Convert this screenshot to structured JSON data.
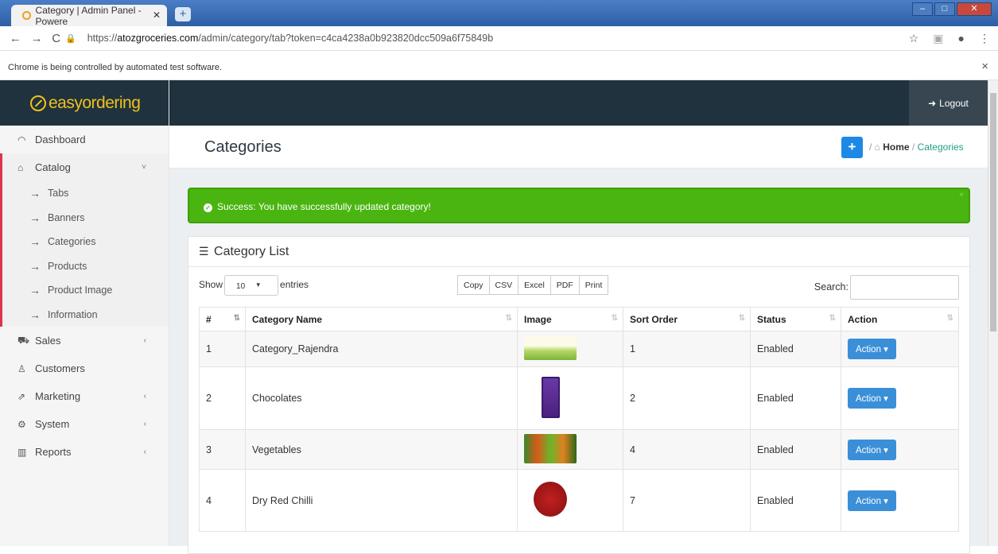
{
  "browser": {
    "tab_title": "Category | Admin Panel - Powere",
    "url_prefix": "https://",
    "url_domain": "atozgroceries.com",
    "url_path": "/admin/category/tab?token=c4ca4238a0b923820dcc509a6f75849b",
    "infobar": "Chrome is being controlled by automated test software."
  },
  "brand": {
    "name": "easyordering"
  },
  "topbar": {
    "logout": "Logout"
  },
  "sidebar": {
    "dashboard": "Dashboard",
    "catalog": "Catalog",
    "sub": [
      "Tabs",
      "Banners",
      "Categories",
      "Products",
      "Product Image",
      "Information"
    ],
    "sales": "Sales",
    "customers": "Customers",
    "marketing": "Marketing",
    "system": "System",
    "reports": "Reports"
  },
  "page": {
    "title": "Categories",
    "breadcrumb_home": "Home",
    "breadcrumb_current": "Categories",
    "add": "+"
  },
  "alert": {
    "text": "Success: You have successfully updated category!"
  },
  "card": {
    "title": "Category List"
  },
  "controls": {
    "show": "Show",
    "entries_value": "10",
    "entries": "entries",
    "buttons": [
      "Copy",
      "CSV",
      "Excel",
      "PDF",
      "Print"
    ],
    "search": "Search:"
  },
  "table": {
    "headers": [
      "#",
      "Category Name",
      "Image",
      "Sort Order",
      "Status",
      "Action"
    ],
    "rows": [
      {
        "n": "1",
        "name": "Category_Rajendra",
        "sort": "1",
        "status": "Enabled",
        "action": "Action"
      },
      {
        "n": "2",
        "name": "Chocolates",
        "sort": "2",
        "status": "Enabled",
        "action": "Action"
      },
      {
        "n": "3",
        "name": "Vegetables",
        "sort": "4",
        "status": "Enabled",
        "action": "Action"
      },
      {
        "n": "4",
        "name": "Dry Red Chilli",
        "sort": "7",
        "status": "Enabled",
        "action": "Action"
      }
    ]
  },
  "colors": {
    "accent": "#1e88e5",
    "success": "#4ab510",
    "navbar": "#1f323d",
    "brand": "#f0c020",
    "catalog_marker": "#e0334a"
  }
}
